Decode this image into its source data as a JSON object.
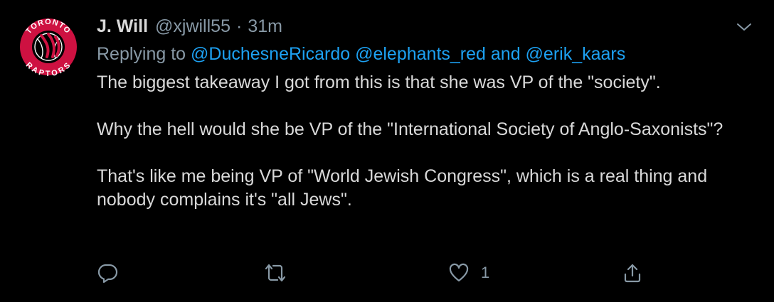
{
  "tweet": {
    "display_name": "J. Will",
    "handle": "@xjwill55",
    "separator": "·",
    "time": "31m",
    "avatar_team": {
      "top_text": "TORONTO",
      "bottom_text": "RAPTORS"
    },
    "reply": {
      "prefix": "Replying to ",
      "mention_1": "@DuchesneRicardo",
      "space": " ",
      "mention_2": "@elephants_red",
      "conjunction": " and ",
      "mention_3": "@erik_kaars"
    },
    "paragraphs": [
      "The biggest takeaway I got from this is that she was VP of the \"society\".",
      "Why the hell would she be VP of the \"International Society of Anglo-Saxonists\"?",
      "That's like me being VP of \"World Jewish Congress\", which is a real thing and nobody complains it's \"all Jews\"."
    ],
    "actions": {
      "reply_icon": "reply-bubble-icon",
      "retweet_icon": "retweet-icon",
      "like_icon": "heart-icon",
      "like_count": "1",
      "share_icon": "share-icon"
    }
  },
  "colors": {
    "background": "#000000",
    "text": "#d9d9d9",
    "muted": "#8899a6",
    "accent": "#1da1f2",
    "avatar_red": "#ce1141"
  }
}
